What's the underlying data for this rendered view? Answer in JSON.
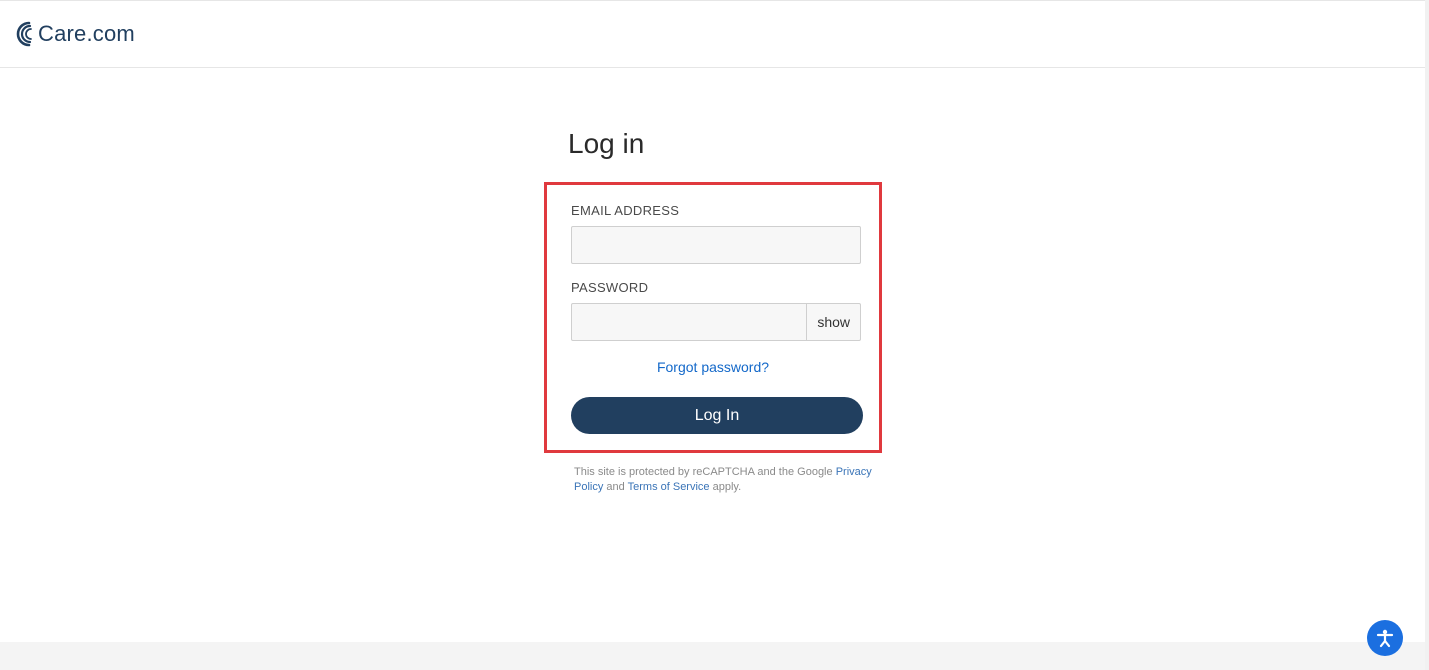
{
  "brand": {
    "name": "Care.com"
  },
  "page": {
    "title": "Log in"
  },
  "fields": {
    "email": {
      "label": "EMAIL ADDRESS",
      "value": ""
    },
    "password": {
      "label": "PASSWORD",
      "value": "",
      "toggle_label": "show"
    }
  },
  "links": {
    "forgot": "Forgot password?",
    "privacy": "Privacy Policy",
    "tos": "Terms of Service"
  },
  "buttons": {
    "login": "Log In"
  },
  "legal": {
    "prefix": "This site is protected by reCAPTCHA and the Google ",
    "mid": " and ",
    "suffix": " apply."
  }
}
